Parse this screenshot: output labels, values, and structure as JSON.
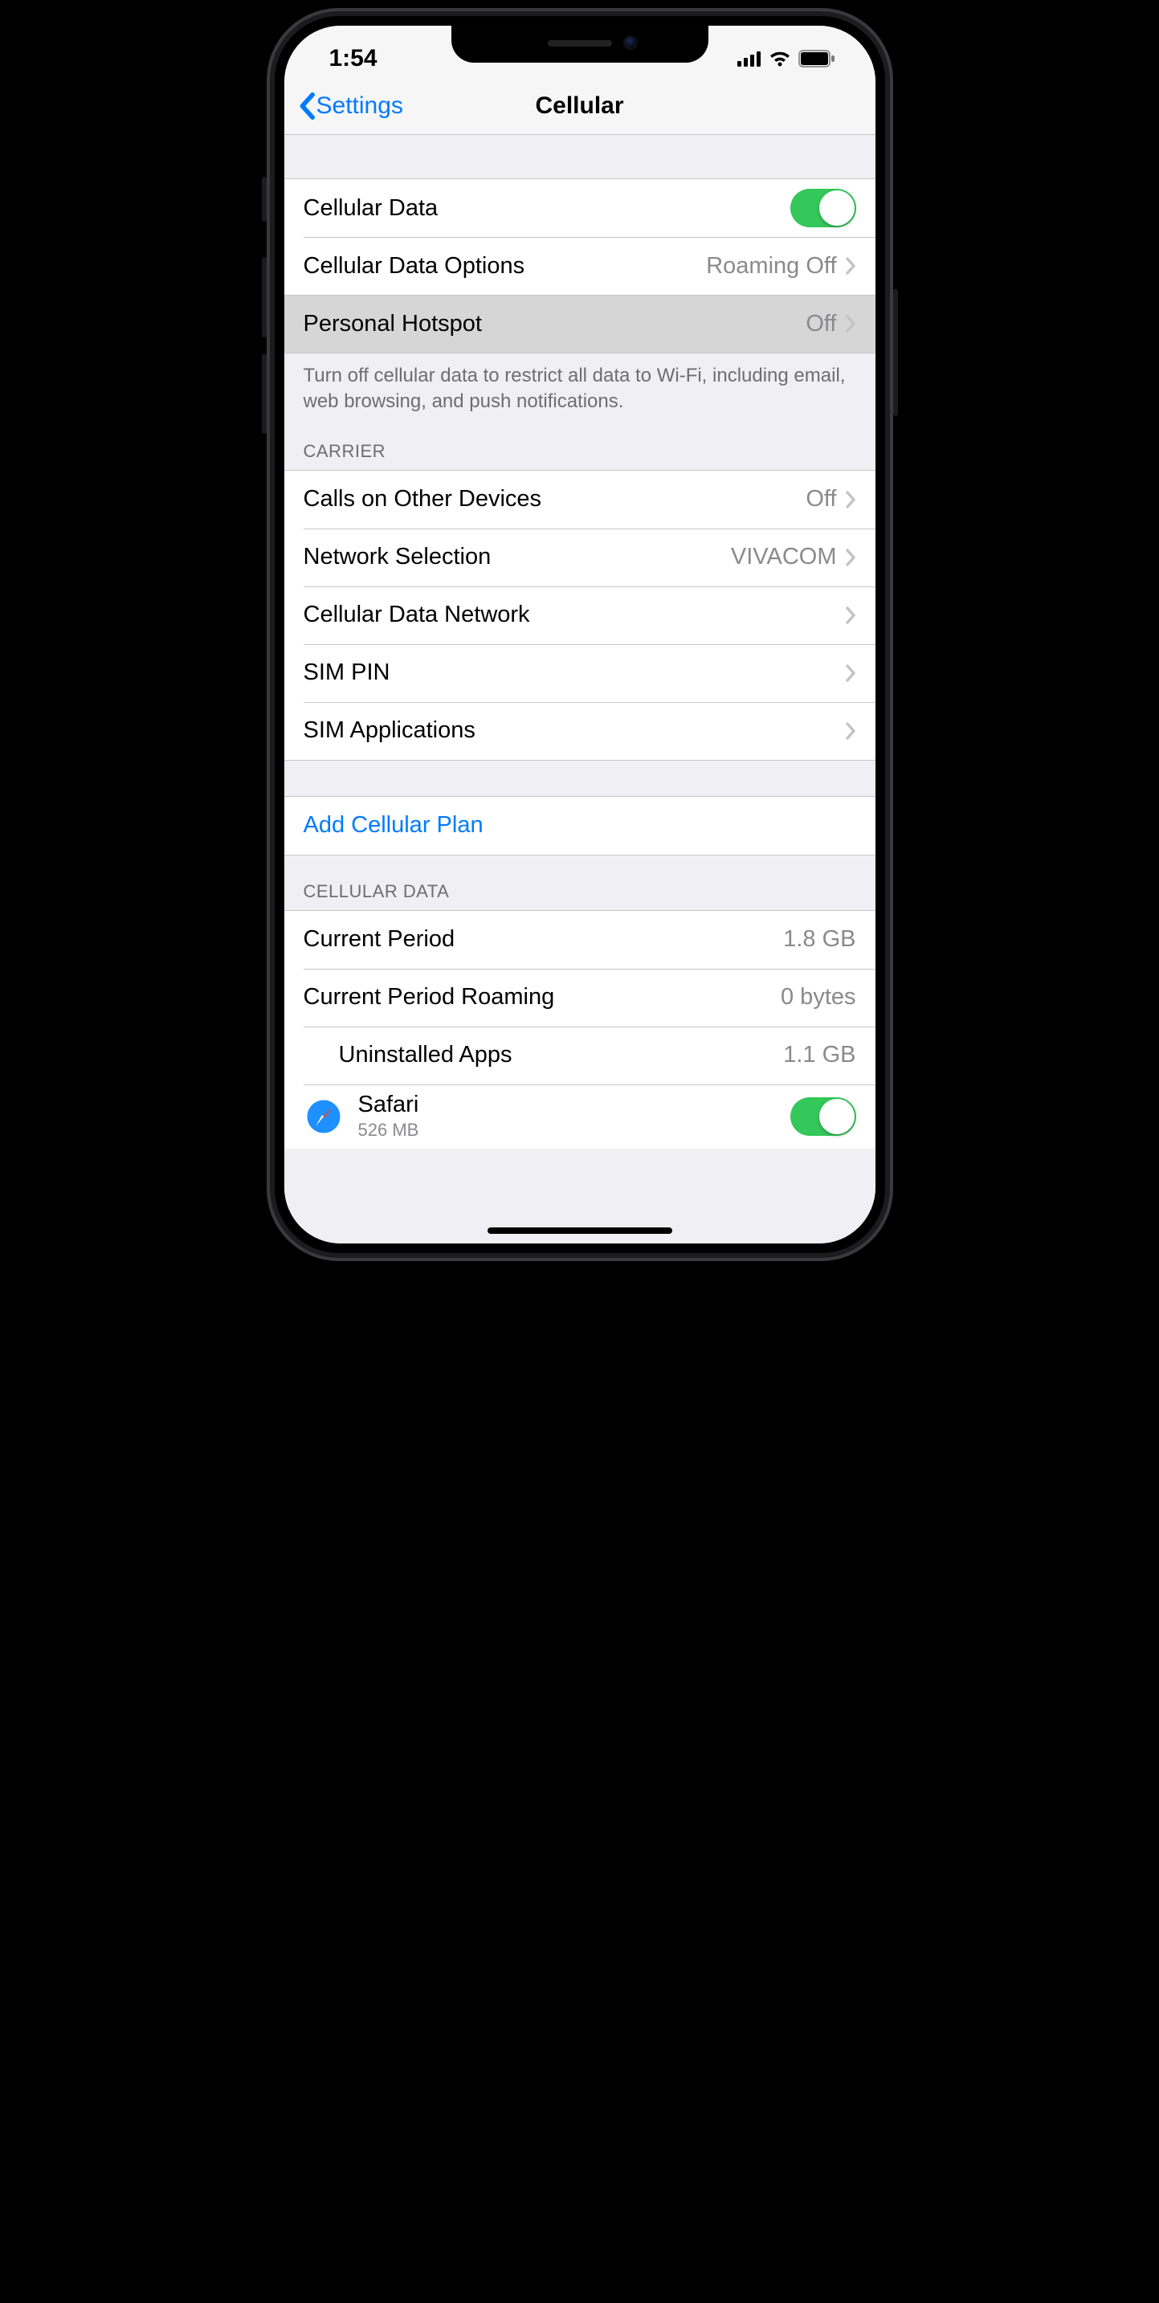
{
  "status": {
    "time": "1:54"
  },
  "nav": {
    "back": "Settings",
    "title": "Cellular"
  },
  "section_main": {
    "cellular_data": {
      "label": "Cellular Data",
      "on": true
    },
    "options": {
      "label": "Cellular Data Options",
      "value": "Roaming Off"
    },
    "hotspot": {
      "label": "Personal Hotspot",
      "value": "Off"
    },
    "footer": "Turn off cellular data to restrict all data to Wi-Fi, including email, web browsing, and push notifications."
  },
  "section_carrier": {
    "header": "CARRIER",
    "calls": {
      "label": "Calls on Other Devices",
      "value": "Off"
    },
    "network": {
      "label": "Network Selection",
      "value": "VIVACOM"
    },
    "data_network": {
      "label": "Cellular Data Network"
    },
    "sim_pin": {
      "label": "SIM PIN"
    },
    "sim_apps": {
      "label": "SIM Applications"
    }
  },
  "section_plan": {
    "add": "Add Cellular Plan"
  },
  "section_usage": {
    "header": "CELLULAR DATA",
    "current": {
      "label": "Current Period",
      "value": "1.8 GB"
    },
    "roaming": {
      "label": "Current Period Roaming",
      "value": "0 bytes"
    },
    "uninstalled": {
      "label": "Uninstalled Apps",
      "value": "1.1 GB"
    },
    "safari": {
      "label": "Safari",
      "sub": "526 MB",
      "on": true
    }
  }
}
